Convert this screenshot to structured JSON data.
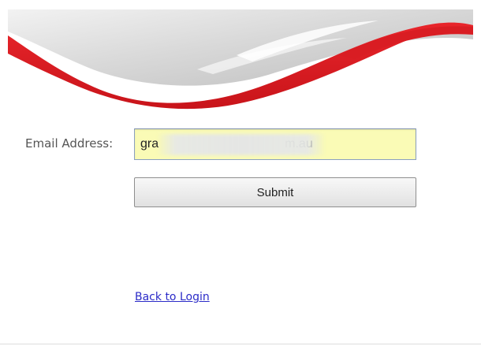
{
  "form": {
    "email_label": "Email Address:",
    "email_value": "gra                                    m.au",
    "submit_label": "Submit"
  },
  "links": {
    "back_to_login": "Back to Login"
  },
  "colors": {
    "brand_red": "#d91d23",
    "input_background": "#fafbb6",
    "link_color": "#2b2bc8"
  }
}
